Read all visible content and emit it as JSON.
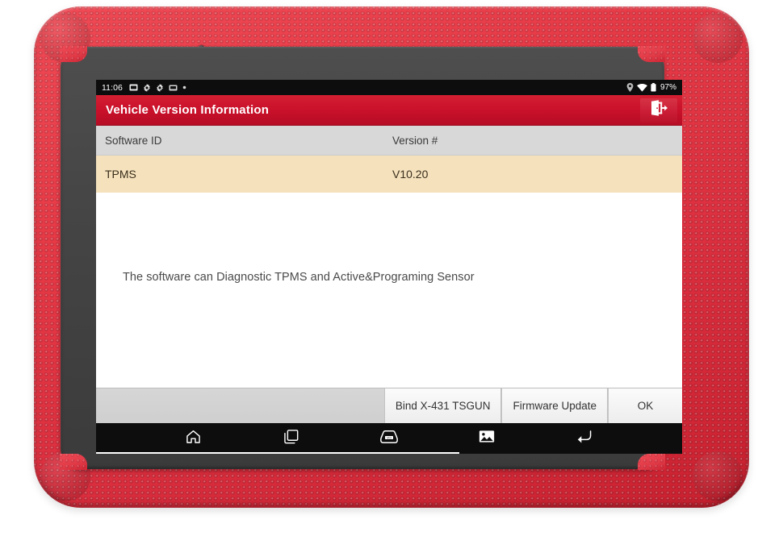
{
  "device": {
    "case_color": "#e63946",
    "bezel_color": "#454545",
    "camera_icon": "camera-dot"
  },
  "status_bar": {
    "time": "11:06",
    "left_icons": [
      "sd-card-icon",
      "settings-gear-icon",
      "settings-gear-icon",
      "sim-card-icon",
      "dot-icon"
    ],
    "right_icons": [
      "location-icon",
      "wifi-icon",
      "battery-icon"
    ],
    "battery_percent": "97%"
  },
  "title_bar": {
    "title": "Vehicle Version Information",
    "background": "#c8102a",
    "exit_icon": "exit-door-icon"
  },
  "table": {
    "columns": [
      "Software ID",
      "Version #"
    ],
    "rows": [
      {
        "software_id": "TPMS",
        "version": "V10.20"
      }
    ],
    "header_background": "#d8d8d8",
    "row_background": "#f5e2bd"
  },
  "body": {
    "description": "The software can Diagnostic TPMS and Active&Programing Sensor"
  },
  "buttons": [
    {
      "label": "Bind X-431 TSGUN",
      "name": "bind-tsgun-button"
    },
    {
      "label": "Firmware Update",
      "name": "firmware-update-button"
    },
    {
      "label": "OK",
      "name": "ok-button"
    }
  ],
  "nav_bar": {
    "items": [
      "home-icon",
      "recents-icon",
      "vci-connector-icon",
      "screenshot-image-icon",
      "back-arrow-icon"
    ]
  }
}
